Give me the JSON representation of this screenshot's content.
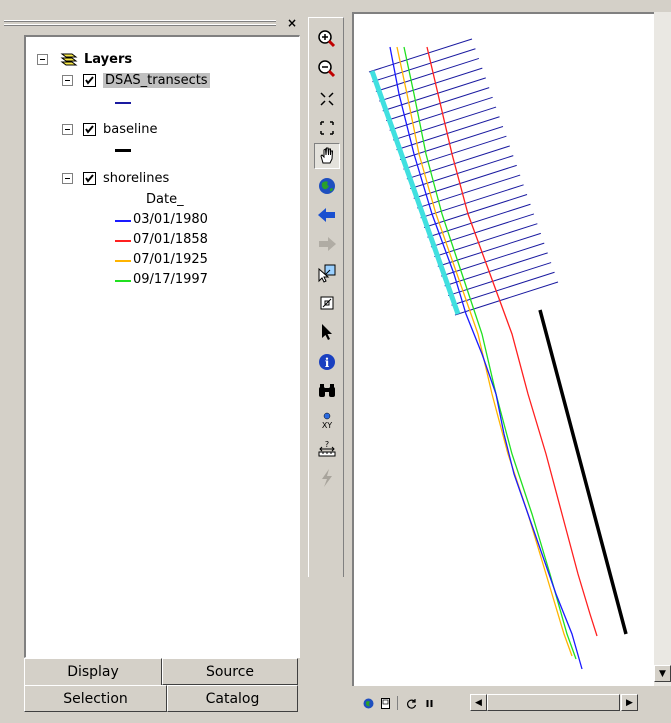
{
  "toc": {
    "close_label": "×",
    "root_label": "Layers",
    "layers": [
      {
        "name": "DSAS_transects",
        "selected": true,
        "checked": true
      },
      {
        "name": "baseline",
        "selected": false,
        "checked": true
      },
      {
        "name": "shorelines",
        "selected": false,
        "checked": true
      }
    ],
    "shorelines_field": "Date_",
    "legend": [
      {
        "label": "03/01/1980",
        "color": "#1a1aff"
      },
      {
        "label": "07/01/1858",
        "color": "#ff2020"
      },
      {
        "label": "07/01/1925",
        "color": "#ffb400"
      },
      {
        "label": "09/17/1997",
        "color": "#20e020"
      }
    ],
    "transects_color": "#1a1aa0",
    "baseline_color": "#000000"
  },
  "tabs": {
    "display": "Display",
    "source": "Source",
    "selection": "Selection",
    "catalog": "Catalog"
  },
  "tools": [
    "zoom-in-icon",
    "zoom-out-icon",
    "fixed-zoom-in-icon",
    "fixed-zoom-out-icon",
    "pan-icon",
    "full-extent-icon",
    "back-icon",
    "forward-icon",
    "select-features-icon",
    "clear-selection-icon",
    "select-elements-icon",
    "identify-icon",
    "find-icon",
    "go-to-xy-icon",
    "measure-icon",
    "hyperlink-icon"
  ],
  "map": {
    "baseline_color": "#40e0e0",
    "transect_color": "#1a1aa0"
  }
}
